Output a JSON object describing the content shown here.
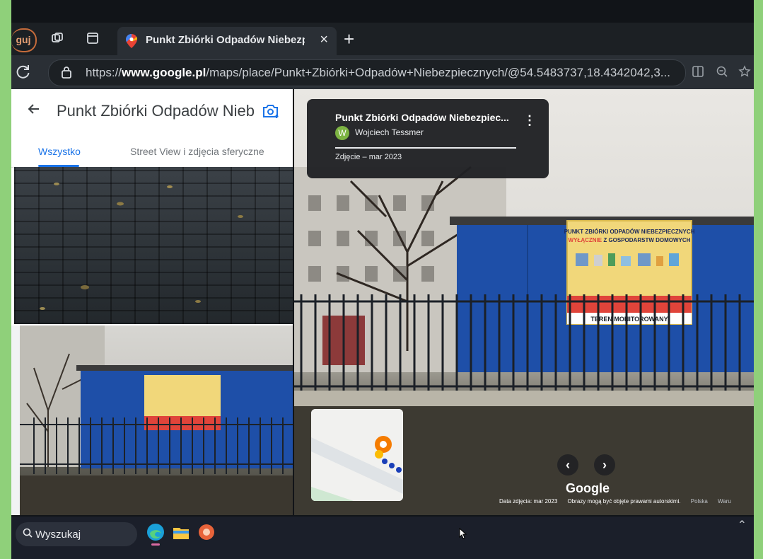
{
  "browser": {
    "profile_label": "guj",
    "active_tab": {
      "title": "Punkt Zbiórki Odpadów Niebezpi",
      "close": "×"
    },
    "new_tab": "+",
    "url_prefix": "https://",
    "url_host": "www.google.pl",
    "url_path": "/maps/place/Punkt+Zbiórki+Odpadów+Niebezpiecznych/@54.5483737,18.4342042,3..."
  },
  "left_panel": {
    "title": "Punkt Zbiórki Odpadów Nieb...",
    "tabs": [
      {
        "label": "Wszystko"
      },
      {
        "label": "Street View i zdjęcia sferyczne"
      }
    ]
  },
  "street_view": {
    "info_card": {
      "title": "Punkt Zbiórki Odpadów Niebezpiec...",
      "author_initial": "W",
      "author": "Wojciech Tessmer",
      "date": "Zdjęcie – mar 2023"
    },
    "sign": {
      "line1": "PUNKT ZBIÓRKI ODPADÓW NIEBEZPIECZNYCH",
      "line2a": "WYŁĄCZNIE",
      "line2b": " Z GOSPODARSTW DOMOWYCH",
      "footer": "TEREN MONITOROWANY"
    },
    "google": "Google",
    "footer": {
      "date": "Data zdjęcia: mar 2023",
      "copyright": "Obrazy mogą być objęte prawami autorskimi.",
      "country": "Polska",
      "more": "Waru"
    }
  },
  "taskbar": {
    "search_label": "Wyszukaj"
  },
  "colors": {
    "accent_blue": "#1a73e8",
    "container_blue": "#1e4fa8",
    "sign_yellow": "#f1d77a",
    "sign_red": "#e0443a"
  }
}
